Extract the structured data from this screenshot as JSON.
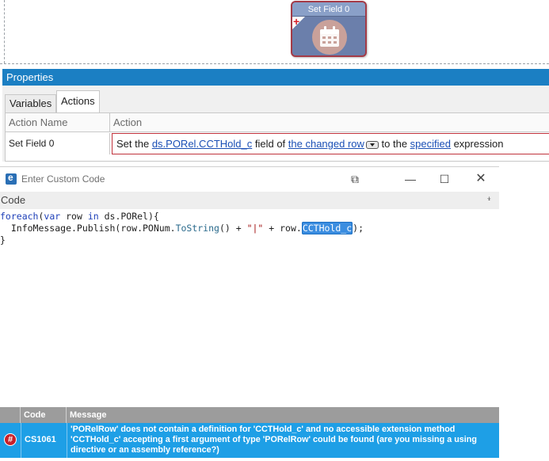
{
  "workflow": {
    "node_title": "Set Field 0",
    "node_plus": "+",
    "node_icon": "calendar-icon"
  },
  "properties": {
    "title": "Properties",
    "tabs": [
      {
        "label": "Variables",
        "active": false
      },
      {
        "label": "Actions",
        "active": true
      }
    ],
    "grid": {
      "headers": [
        "Action Name",
        "Action"
      ],
      "row": {
        "name": "Set Field 0",
        "action_parts": {
          "p1": "Set the ",
          "link1": "ds.PORel.CCTHold_c",
          "p2": " field of ",
          "link2": "the changed row",
          "p3": " to the ",
          "link3": "specified",
          "p4": " expression"
        }
      }
    }
  },
  "code_window": {
    "title": "Enter Custom Code",
    "controls": {
      "restore": "⧉",
      "minimize": "—",
      "maximize": "☐",
      "close": "✕"
    },
    "pane_label": "Code",
    "pin": "📌",
    "code": {
      "l1_kw1": "foreach",
      "l1_a": "(",
      "l1_kw2": "var",
      "l1_b": " row ",
      "l1_kw3": "in",
      "l1_c": " ds.PORel){",
      "l2_a": "  InfoMessage.Publish(row.PONum.",
      "l2_method": "ToString",
      "l2_b": "() + ",
      "l2_str": "\"|\"",
      "l2_c": " + row.",
      "l2_sel": "CCTHold_c",
      "l2_d": ");",
      "l3": "}"
    }
  },
  "errors": {
    "headers": {
      "icon": "",
      "code": "Code",
      "message": "Message"
    },
    "rows": [
      {
        "icon": "#",
        "code": "CS1061",
        "message": "'PORelRow' does not contain a definition for 'CCTHold_c' and no accessible extension method 'CCTHold_c' accepting a first argument of type 'PORelRow' could be found (are you missing a using directive or an assembly reference?)"
      }
    ]
  },
  "colors": {
    "accent": "#1b7fc3",
    "node_border": "#a43b47",
    "error_row": "#1e9fe6",
    "link": "#1a4fb5"
  }
}
